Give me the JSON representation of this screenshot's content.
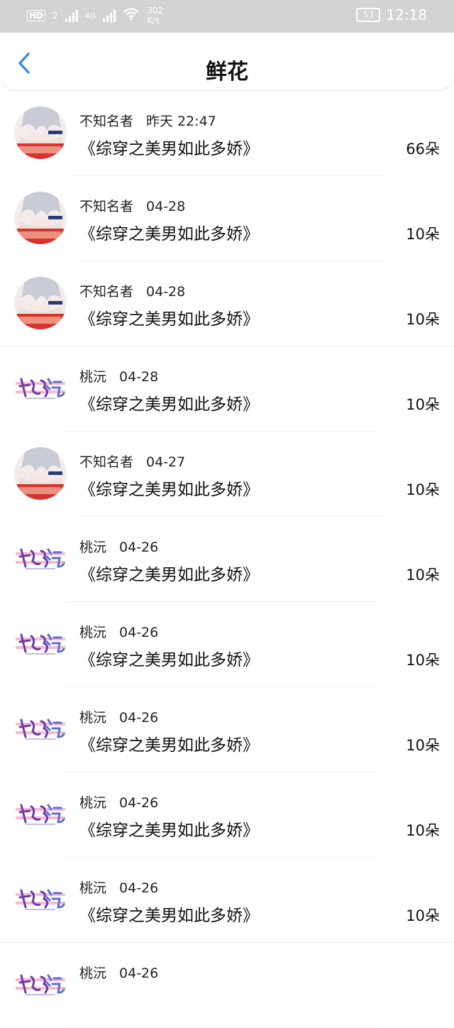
{
  "status_bar": {
    "hd": "HD",
    "sim": "2",
    "net": "4G",
    "speed_value": "302",
    "speed_unit": "K/s",
    "battery": "53",
    "time": "12:18"
  },
  "header": {
    "title": "鲜花"
  },
  "items": [
    {
      "user": "不知名者",
      "date": "昨天 22:47",
      "book": "《综穿之美男如此多娇》",
      "count": "66朵",
      "avatar": "anime-portrait"
    },
    {
      "user": "不知名者",
      "date": "04-28",
      "book": "《综穿之美男如此多娇》",
      "count": "10朵",
      "avatar": "anime-portrait"
    },
    {
      "user": "不知名者",
      "date": "04-28",
      "book": "《综穿之美男如此多娇》",
      "count": "10朵",
      "avatar": "anime-portrait"
    },
    {
      "user": "桃沅",
      "date": "04-28",
      "book": "《综穿之美男如此多娇》",
      "count": "10朵",
      "avatar": "taoyuan-logo"
    },
    {
      "user": "不知名者",
      "date": "04-27",
      "book": "《综穿之美男如此多娇》",
      "count": "10朵",
      "avatar": "anime-portrait"
    },
    {
      "user": "桃沅",
      "date": "04-26",
      "book": "《综穿之美男如此多娇》",
      "count": "10朵",
      "avatar": "taoyuan-logo"
    },
    {
      "user": "桃沅",
      "date": "04-26",
      "book": "《综穿之美男如此多娇》",
      "count": "10朵",
      "avatar": "taoyuan-logo"
    },
    {
      "user": "桃沅",
      "date": "04-26",
      "book": "《综穿之美男如此多娇》",
      "count": "10朵",
      "avatar": "taoyuan-logo"
    },
    {
      "user": "桃沅",
      "date": "04-26",
      "book": "《综穿之美男如此多娇》",
      "count": "10朵",
      "avatar": "taoyuan-logo"
    },
    {
      "user": "桃沅",
      "date": "04-26",
      "book": "《综穿之美男如此多娇》",
      "count": "10朵",
      "avatar": "taoyuan-logo"
    },
    {
      "user": "桃沅",
      "date": "04-26",
      "book": "",
      "count": "",
      "avatar": "taoyuan-logo"
    }
  ],
  "colors": {
    "accent": "#3a8ee6",
    "status_bar_bg": "#d3d3d3"
  }
}
